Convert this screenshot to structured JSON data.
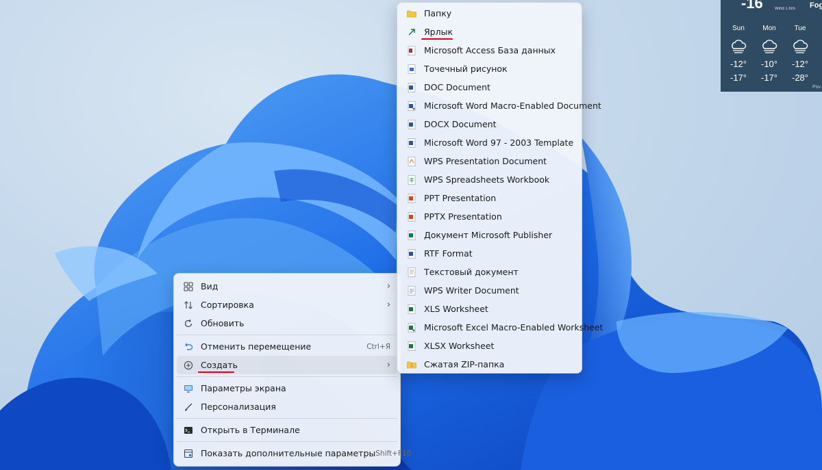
{
  "colors": {
    "accent_underline": "#d1001f",
    "weather_bg": "#2f4a63"
  },
  "weather": {
    "temp_partial": "-16",
    "wind": "Wind 1 m/s",
    "condition_partial": "Fog",
    "more_partial": "Pov",
    "days": [
      {
        "name": "Sun",
        "high": "-12°",
        "low": "-17°",
        "icon": "snow-cloud-icon"
      },
      {
        "name": "Mon",
        "high": "-10°",
        "low": "-17°",
        "icon": "snow-cloud-icon"
      },
      {
        "name": "Tue",
        "high": "-12°",
        "low": "-28°",
        "icon": "snow-cloud-icon"
      }
    ]
  },
  "context_menu": {
    "view": "Вид",
    "sort": "Сортировка",
    "refresh": "Обновить",
    "undo_move": "Отменить перемещение",
    "undo_shortcut": "Ctrl+Я",
    "create": "Создать",
    "display_settings": "Параметры экрана",
    "personalize": "Персонализация",
    "open_terminal": "Открыть в Терминале",
    "more_options": "Показать дополнительные параметры",
    "more_shortcut": "Shift+F10"
  },
  "new_submenu": {
    "items": [
      "Папку",
      "Ярлык",
      "Microsoft Access База данных",
      "Точечный рисунок",
      "DOC Document",
      "Microsoft Word Macro-Enabled Document",
      "DOCX Document",
      "Microsoft Word 97 - 2003 Template",
      "WPS Presentation Document",
      "WPS Spreadsheets Workbook",
      "PPT Presentation",
      "PPTX Presentation",
      "Документ Microsoft Publisher",
      "RTF Format",
      "Текстовый документ",
      "WPS Writer Document",
      "XLS Worksheet",
      "Microsoft Excel Macro-Enabled Worksheet",
      "XLSX Worksheet",
      "Сжатая ZIP-папка"
    ]
  }
}
